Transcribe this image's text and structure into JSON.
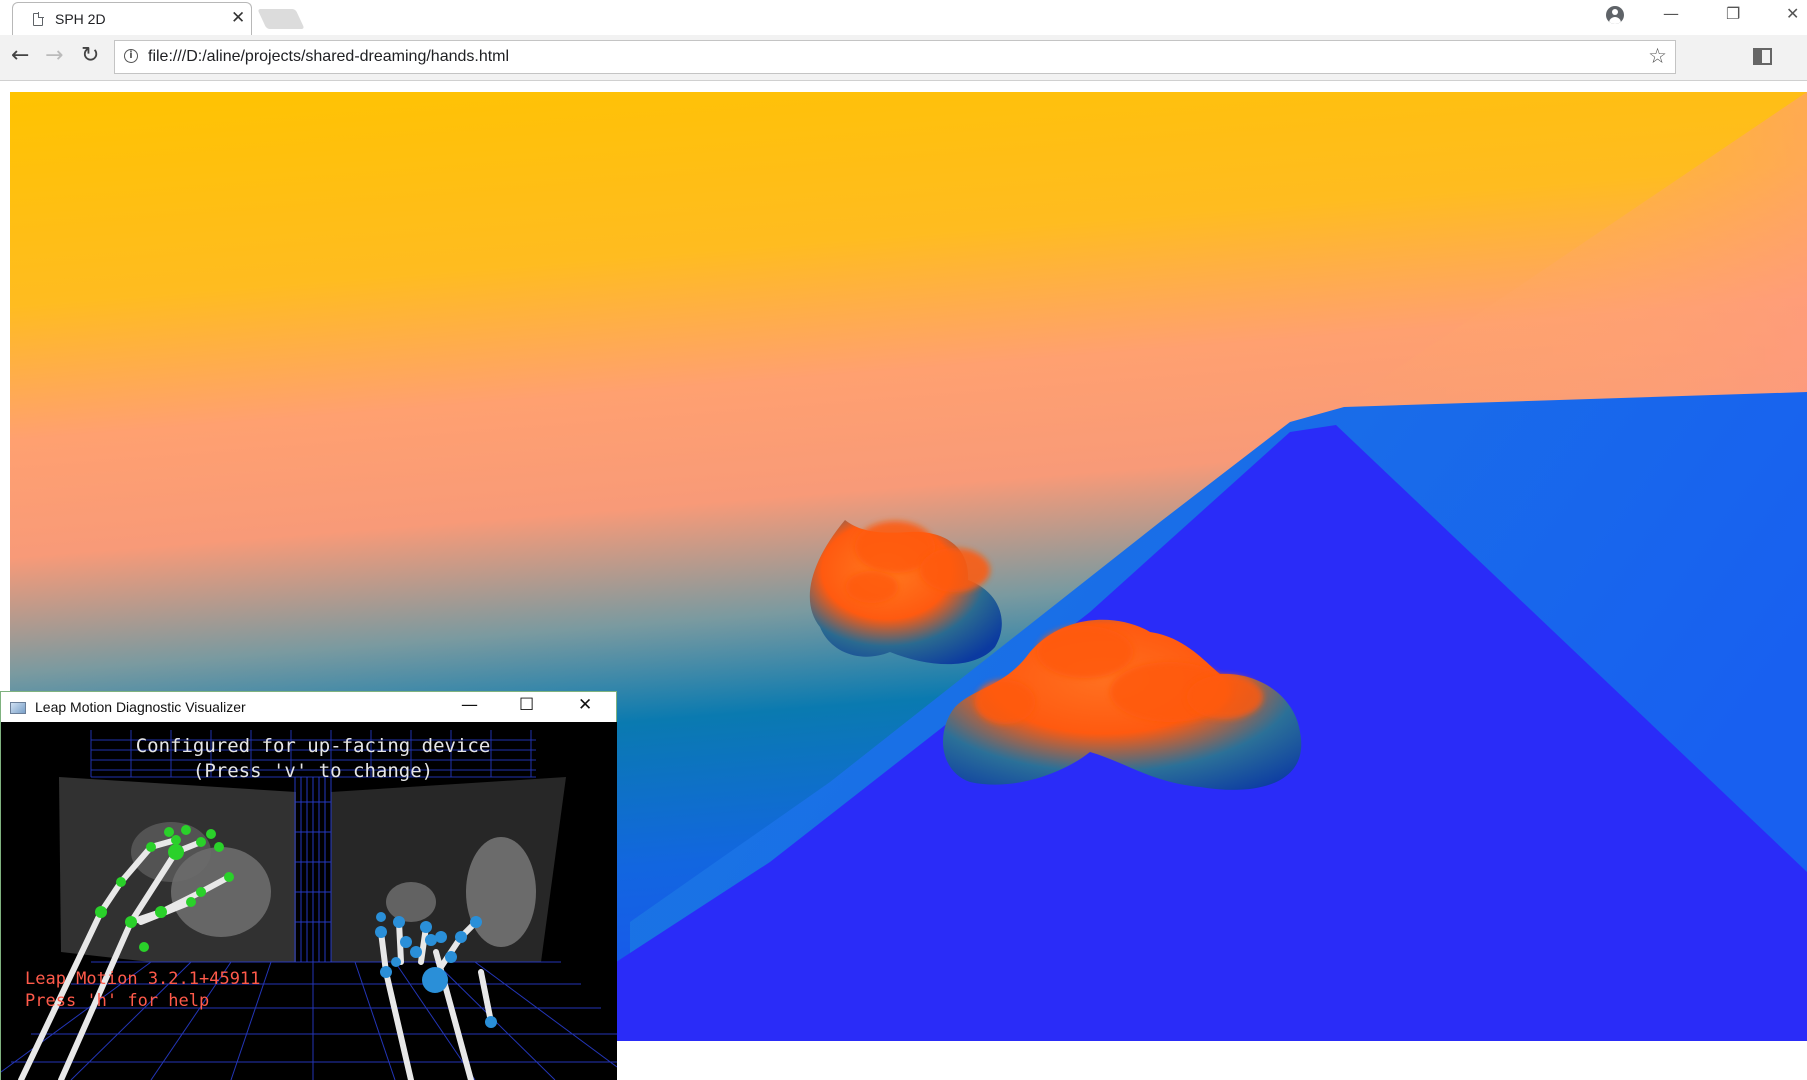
{
  "browser": {
    "tab": {
      "title": "SPH 2D",
      "close": "✕"
    },
    "window_controls": {
      "minimize": "—",
      "restore": "❐",
      "close": "✕"
    },
    "nav": {
      "back": "←",
      "forward": "→",
      "reload": "↻"
    },
    "address": {
      "url": "file:///D:/aline/projects/shared-dreaming/hands.html"
    },
    "menu": "⋮",
    "star": "☆",
    "info": "i"
  },
  "leap_window": {
    "title": "Leap Motion Diagnostic Visualizer",
    "controls": {
      "minimize": "—",
      "maximize": "☐",
      "close": "✕"
    },
    "overlay": {
      "line1": "Configured for up-facing device",
      "line2": "(Press 'v' to change)",
      "version": "Leap Motion 3.2.1+45911",
      "help": "Press 'h' for help"
    }
  },
  "colors": {
    "sky_top": "#ffc300",
    "sky_mid": "#ffa070",
    "horizon_teal": "#0a7ab0",
    "floor_blue": "#2a2cf8",
    "blob_orange": "#ff5a10",
    "leap_green": "#2ad12a",
    "leap_blue": "#2a8fd8",
    "leap_text_red": "#ff5a4a",
    "grid_blue": "#2a3fd6"
  }
}
